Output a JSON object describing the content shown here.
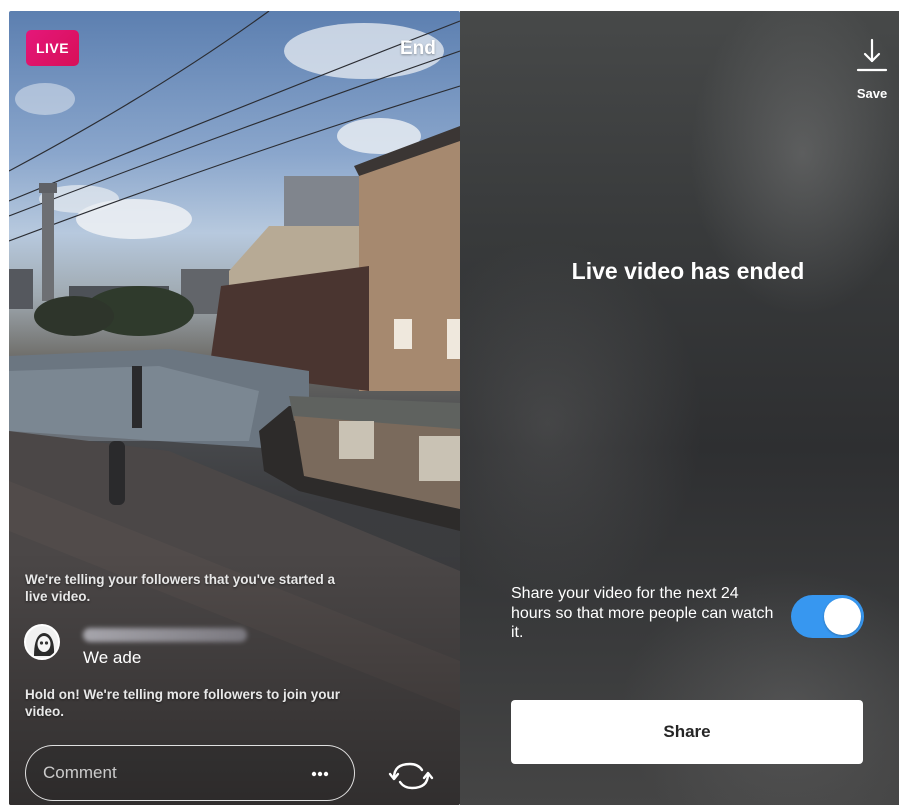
{
  "live_screen": {
    "badge": "LIVE",
    "end_label": "End",
    "notice_started": "We're telling your followers that you've started a live video.",
    "comment": {
      "username_blurred": true,
      "text": "We ade"
    },
    "notice_more": "Hold on! We're telling more followers to join your video.",
    "comment_input": {
      "placeholder": "Comment"
    },
    "icons": {
      "more": "more-dots-icon",
      "flip_camera": "flip-camera-icon"
    }
  },
  "ended_screen": {
    "save_label": "Save",
    "title": "Live video has ended",
    "share_description": "Share your video for the next 24 hours so that more people can watch it.",
    "share_toggle_on": true,
    "share_button_label": "Share",
    "icons": {
      "save": "download-icon"
    }
  },
  "colors": {
    "live_badge": "#e1166f",
    "toggle_on": "#3797f0",
    "share_button_bg": "#ffffff",
    "share_button_text": "#262626"
  }
}
